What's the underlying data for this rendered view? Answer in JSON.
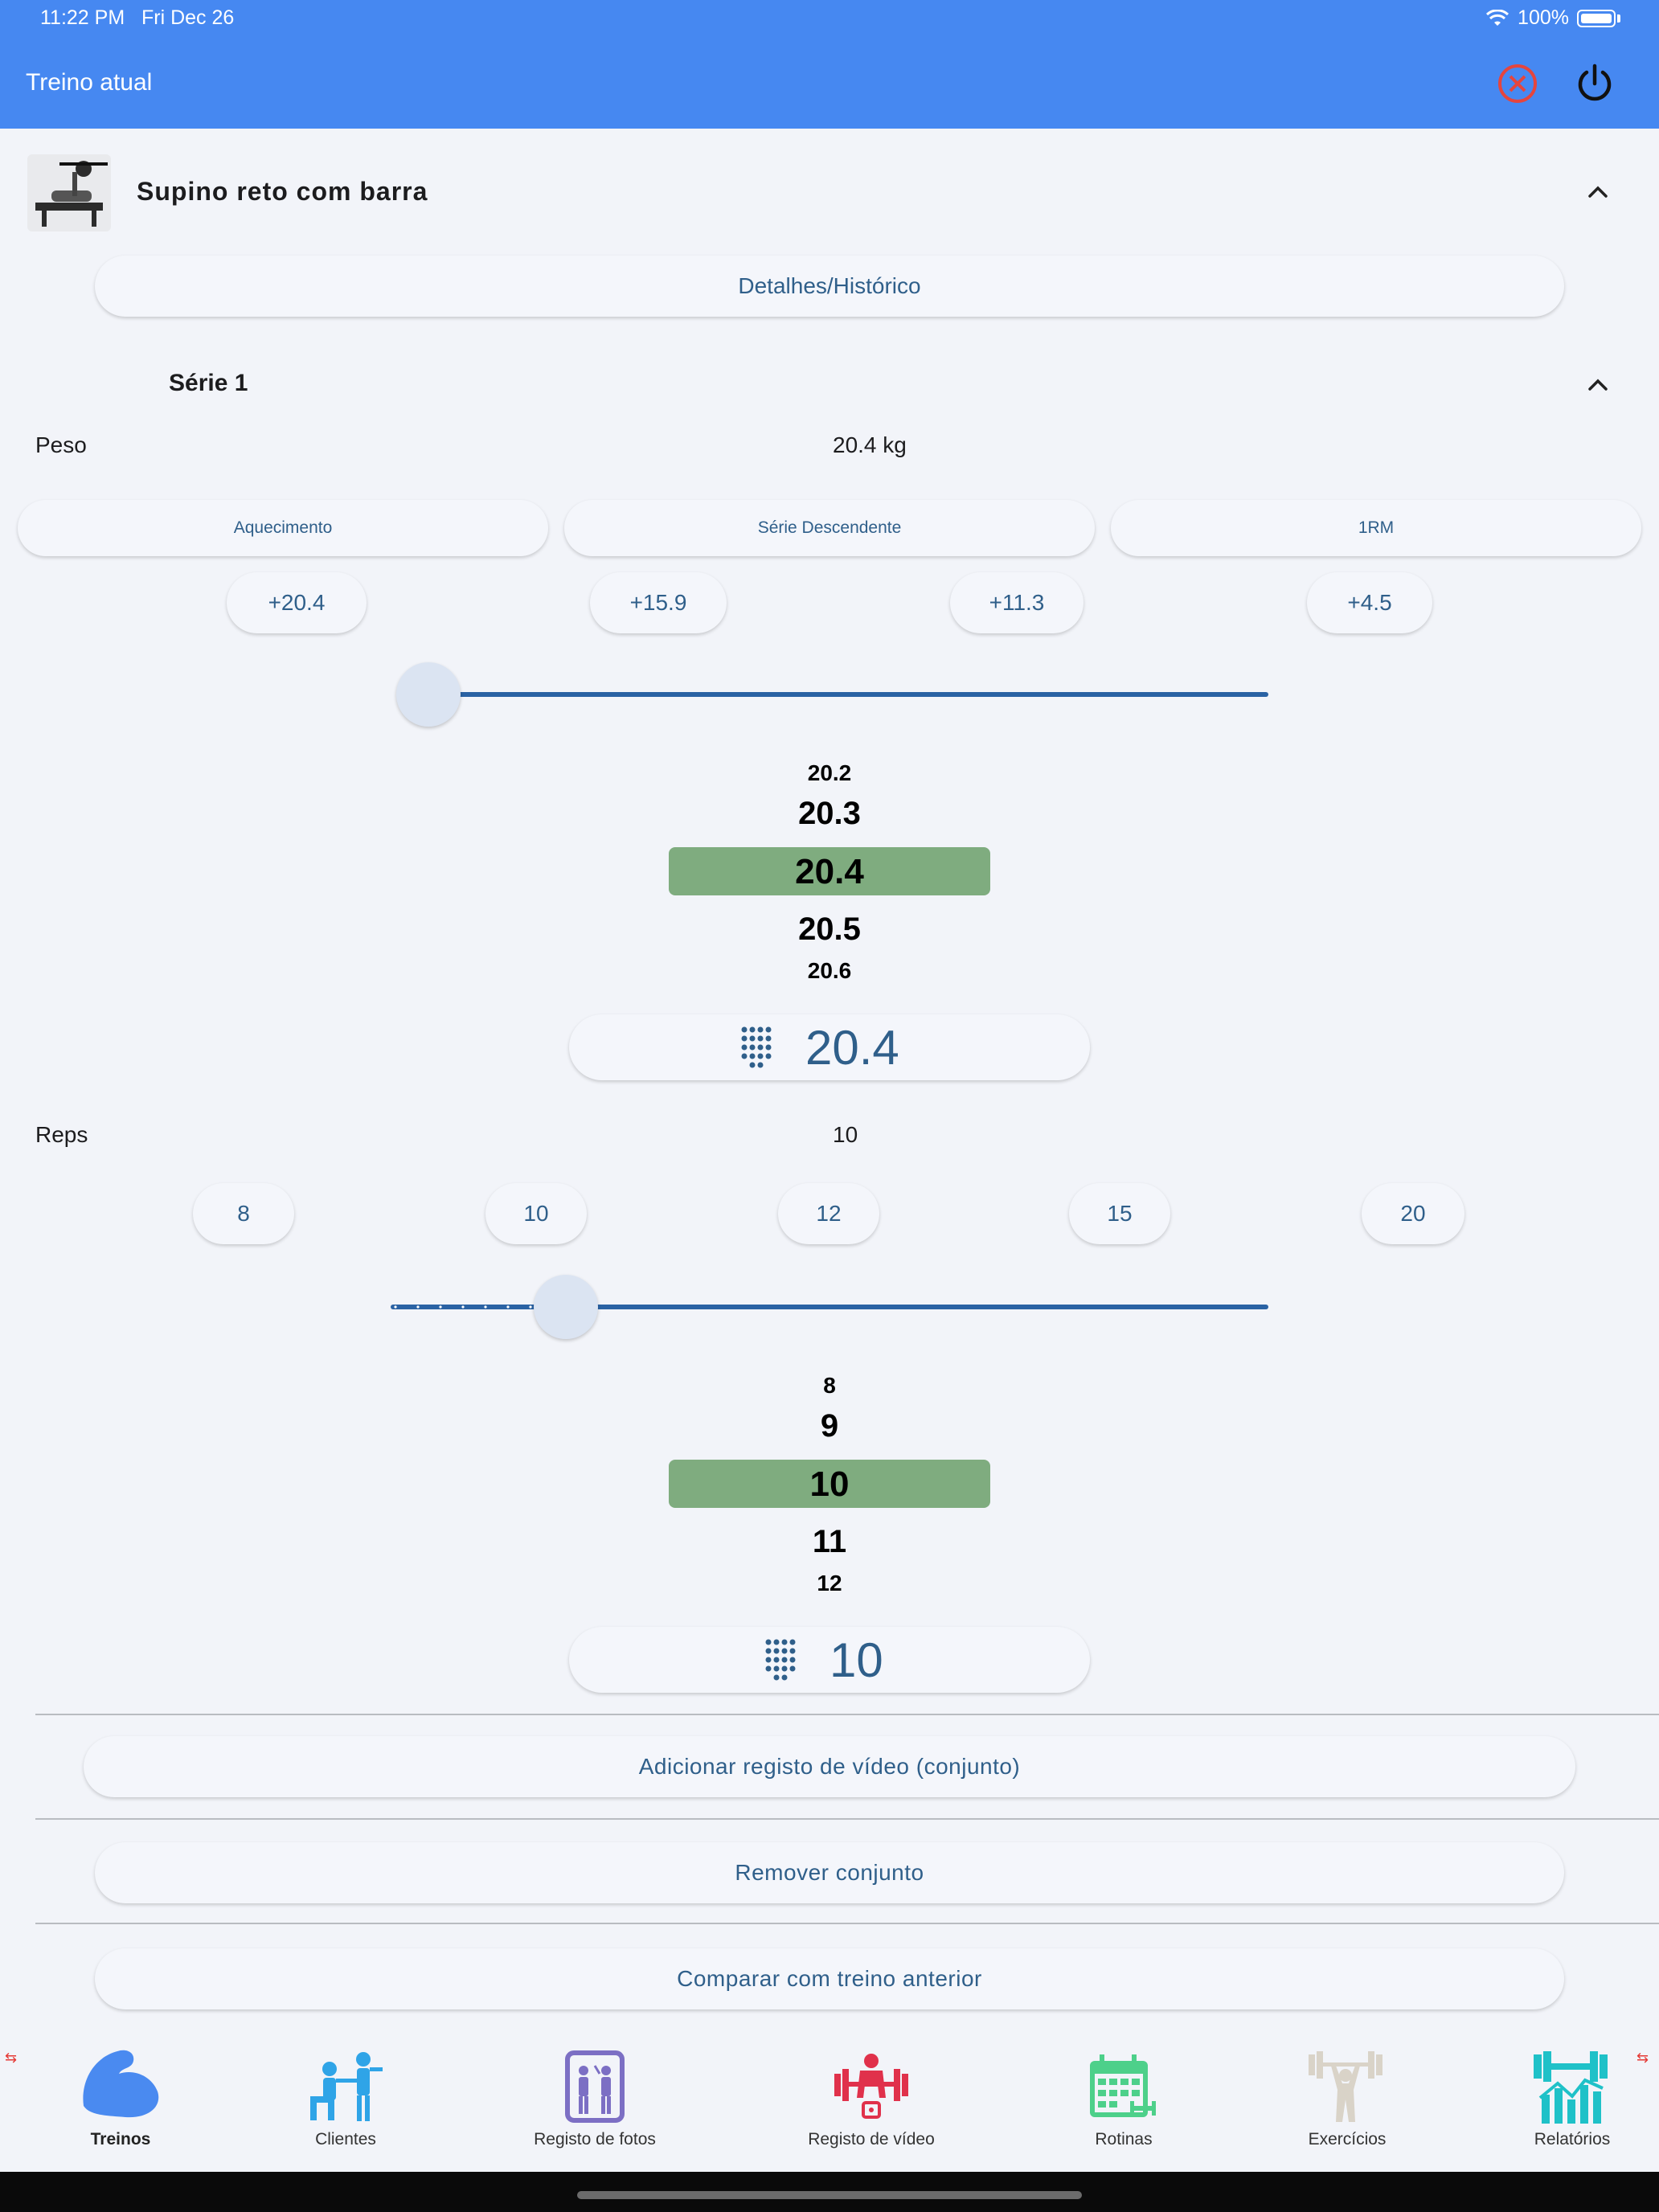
{
  "status_bar": {
    "time": "11:22 PM",
    "date": "Fri Dec 26",
    "battery": "100%"
  },
  "header": {
    "title": "Treino atual"
  },
  "exercise": {
    "name": "Supino reto com barra",
    "details_button": "Detalhes/Histórico"
  },
  "set": {
    "title": "Série 1",
    "weight_label": "Peso",
    "weight_value": "20.4 kg",
    "mode_buttons": [
      "Aquecimento",
      "Série Descendente",
      "1RM"
    ],
    "weight_increments": [
      "+20.4",
      "+15.9",
      "+11.3",
      "+4.5"
    ],
    "weight_slider_fraction": 0.02,
    "weight_picker": [
      "20.2",
      "20.3",
      "20.4",
      "20.5",
      "20.6"
    ],
    "weight_input": "20.4",
    "reps_label": "Reps",
    "reps_value": "10",
    "reps_presets": [
      "8",
      "10",
      "12",
      "15",
      "20"
    ],
    "reps_slider_fraction": 0.2,
    "reps_picker": [
      "8",
      "9",
      "10",
      "11",
      "12"
    ],
    "reps_input": "10"
  },
  "actions": {
    "add_video": "Adicionar registo de vídeo (conjunto)",
    "remove_set": "Remover conjunto",
    "compare": "Comparar com treino anterior"
  },
  "tabs": [
    {
      "label": "Treinos",
      "icon": "bicep-icon",
      "active": true
    },
    {
      "label": "Clientes",
      "icon": "trainer-clients-icon"
    },
    {
      "label": "Registo de fotos",
      "icon": "mirror-photo-icon"
    },
    {
      "label": "Registo de vídeo",
      "icon": "weightlifter-video-icon"
    },
    {
      "label": "Rotinas",
      "icon": "calendar-icon"
    },
    {
      "label": "Exercícios",
      "icon": "barbell-overhead-icon"
    },
    {
      "label": "Relatórios",
      "icon": "chart-dumbbell-icon"
    }
  ],
  "colors": {
    "header": "#4688f1",
    "accent": "#2f5f8a",
    "picker_selected": "#7fac7f",
    "close_red": "#e5453d"
  }
}
